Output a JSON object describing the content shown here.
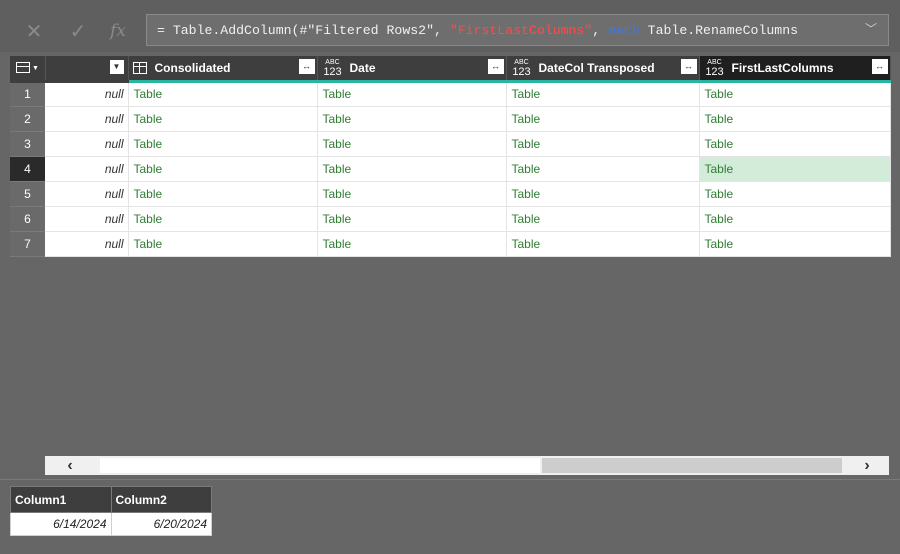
{
  "formula_bar": {
    "cancel_icon": "close-icon",
    "commit_icon": "check-icon",
    "fx_label": "fx",
    "formula_prefix": "= Table.AddColumn(#\"Filtered Rows2\", ",
    "formula_string": "\"FirstLastColumns\"",
    "formula_mid": ", ",
    "formula_keyword": "each",
    "formula_suffix": " Table.RenameColumns",
    "expand_icon": "chevron-down-icon"
  },
  "grid": {
    "columns": [
      {
        "name": "Consolidated",
        "type": "table"
      },
      {
        "name": "Date",
        "type": "ABC123"
      },
      {
        "name": "DateCol Transposed",
        "type": "ABC123"
      },
      {
        "name": "FirstLastColumns",
        "type": "ABC123"
      }
    ],
    "type_abc": "ABC",
    "type_123": "123",
    "rows": [
      {
        "num": "1",
        "null": "null",
        "cells": [
          "Table",
          "Table",
          "Table",
          "Table"
        ]
      },
      {
        "num": "2",
        "null": "null",
        "cells": [
          "Table",
          "Table",
          "Table",
          "Table"
        ]
      },
      {
        "num": "3",
        "null": "null",
        "cells": [
          "Table",
          "Table",
          "Table",
          "Table"
        ]
      },
      {
        "num": "4",
        "null": "null",
        "cells": [
          "Table",
          "Table",
          "Table",
          "Table"
        ]
      },
      {
        "num": "5",
        "null": "null",
        "cells": [
          "Table",
          "Table",
          "Table",
          "Table"
        ]
      },
      {
        "num": "6",
        "null": "null",
        "cells": [
          "Table",
          "Table",
          "Table",
          "Table"
        ]
      },
      {
        "num": "7",
        "null": "null",
        "cells": [
          "Table",
          "Table",
          "Table",
          "Table"
        ]
      }
    ],
    "selected_row": "4",
    "active_column": "FirstLastColumns"
  },
  "scrollbar": {
    "left_arrow": "‹",
    "right_arrow": "›"
  },
  "preview": {
    "headers": [
      "Column1",
      "Column2"
    ],
    "rows": [
      [
        "6/14/2024",
        "6/20/2024"
      ]
    ]
  },
  "colors": {
    "background": "#666666",
    "header_bg": "#3e3e3e",
    "quality_bar": "#2ab5a0",
    "table_link": "#2e7d32",
    "selected_cell": "#d3ecd9",
    "formula_string": "#ff4a4a",
    "formula_keyword": "#2f7bff"
  }
}
